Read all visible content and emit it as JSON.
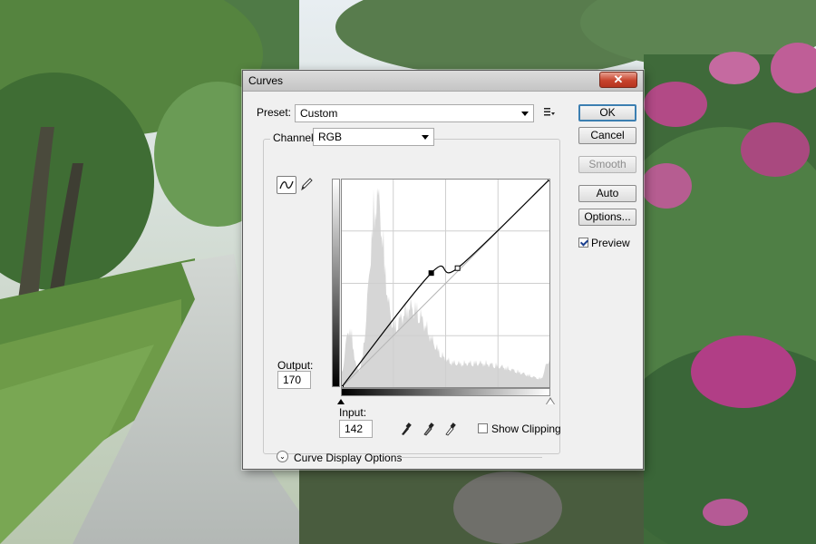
{
  "window": {
    "title": "Curves",
    "close_glyph": "✕"
  },
  "preset": {
    "label": "Preset:",
    "value": "Custom",
    "menu_icon": "list-menu-icon"
  },
  "channel": {
    "label": "Channel:",
    "value": "RGB"
  },
  "buttons": {
    "ok": "OK",
    "cancel": "Cancel",
    "smooth": "Smooth",
    "auto": "Auto",
    "options": "Options..."
  },
  "preview": {
    "label": "Preview",
    "checked": true
  },
  "tools": {
    "curve": "curve-point-icon",
    "pencil": "pencil-icon"
  },
  "output": {
    "label": "Output:",
    "value": "170"
  },
  "input": {
    "label": "Input:",
    "value": "142"
  },
  "show_clipping": {
    "label": "Show Clipping",
    "checked": false
  },
  "curve_display_options": {
    "label": "Curve Display Options"
  },
  "curve": {
    "points": [
      [
        0,
        0
      ],
      [
        110,
        140
      ],
      [
        142,
        146
      ],
      [
        255,
        255
      ]
    ],
    "selected_point_index": 1
  },
  "colors": {
    "title_bar": "#d0d0d0",
    "dialog_bg": "#f0f0f0",
    "close_button": "#c7432c",
    "default_button_border": "#3c7fb1",
    "histogram": "#d6d6d6"
  }
}
